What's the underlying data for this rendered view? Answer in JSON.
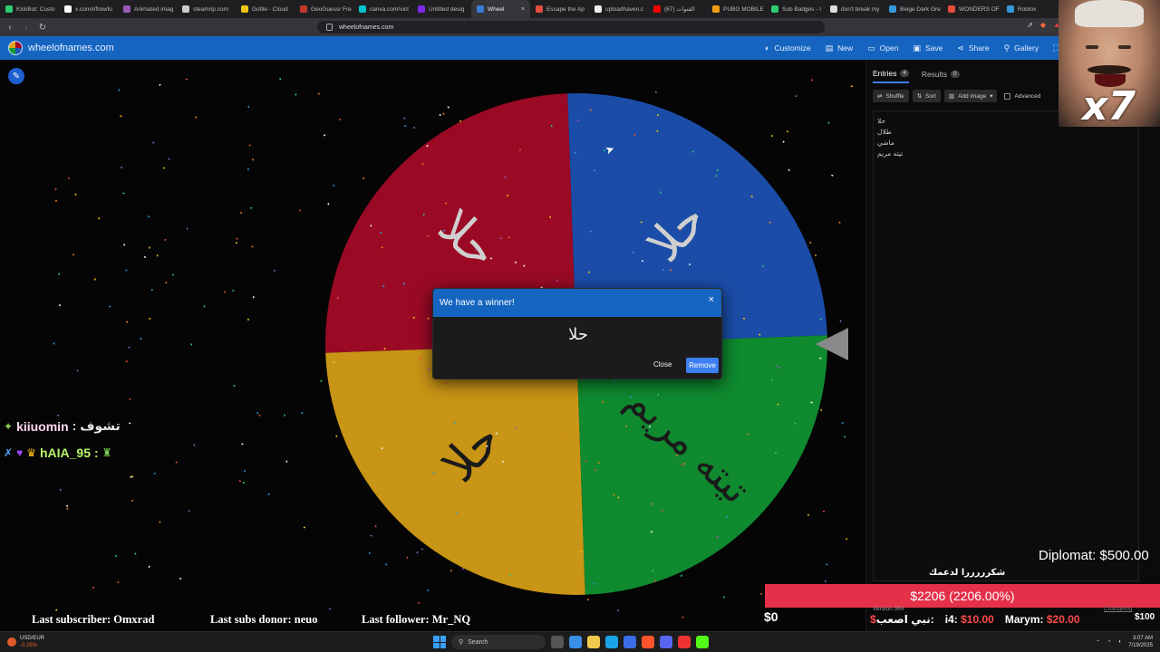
{
  "browser": {
    "tabs": [
      {
        "label": "KickBot: Custo",
        "color": "#2ecc71"
      },
      {
        "label": "x.com/i/flow/lo",
        "color": "#ffffff"
      },
      {
        "label": "Animated imag",
        "color": "#9b59b6"
      },
      {
        "label": "steamrip.com",
        "color": "#cccccc"
      },
      {
        "label": "Gofile - Cloud",
        "color": "#f1c40f"
      },
      {
        "label": "GeoGuessr Fre",
        "color": "#c0392b"
      },
      {
        "label": "canva.com/vict",
        "color": "#00c4cc"
      },
      {
        "label": "Untitled desig",
        "color": "#7d2ae8"
      },
      {
        "label": "Wheel",
        "color": "#3a7bd5",
        "active": true,
        "close": "×"
      },
      {
        "label": "Escape the Ap",
        "color": "#e74c3c"
      },
      {
        "label": "uploadhaven.c",
        "color": "#eeeeee"
      },
      {
        "label": "(67) القنوات",
        "color": "#ff0000"
      },
      {
        "label": "PUBG MOBILE",
        "color": "#f39c12"
      },
      {
        "label": "Sub Badges - I",
        "color": "#2ecc71"
      },
      {
        "label": "don't break my",
        "color": "#dddddd"
      },
      {
        "label": "Beige Dark Gre",
        "color": "#3498db"
      },
      {
        "label": "WONDERS OF",
        "color": "#e74c3c"
      },
      {
        "label": "Roblox",
        "color": "#3498db"
      }
    ],
    "url": "wheelofnames.com"
  },
  "site": {
    "name": "wheelofnames.com",
    "menu": [
      {
        "icon": "palette-icon",
        "glyph": "◐",
        "label": "Customize"
      },
      {
        "icon": "new-file-icon",
        "glyph": "▤",
        "label": "New"
      },
      {
        "icon": "folder-open-icon",
        "glyph": "▭",
        "label": "Open"
      },
      {
        "icon": "save-icon",
        "glyph": "▣",
        "label": "Save"
      },
      {
        "icon": "share-icon",
        "glyph": "⋖",
        "label": "Share"
      },
      {
        "icon": "search-icon",
        "glyph": "⚲",
        "label": "Gallery"
      },
      {
        "icon": "fullscreen-icon",
        "glyph": "⛶",
        "label": ""
      }
    ]
  },
  "wheel": {
    "segments": [
      {
        "label": "حلا",
        "color": "#9a0a25",
        "text_color": "#cfcfcf"
      },
      {
        "label": "طلال",
        "color": "#1b4da8",
        "text_color": "#cfcfcf"
      },
      {
        "label": "ماضي",
        "color": "#0f8a2f",
        "text_color": "#1a1a1a"
      },
      {
        "label": "تيته مريم",
        "color": "#c99516",
        "text_color": "#1a1a1a"
      }
    ],
    "displayed": [
      {
        "label": "حلا",
        "segment": 0
      },
      {
        "label": "حلا",
        "segment": 1
      },
      {
        "label": "تيته مريم",
        "segment": 2
      },
      {
        "label": "حلا",
        "segment": 3
      }
    ]
  },
  "modal": {
    "title": "We have a winner!",
    "close_x": "×",
    "winner": "حلا",
    "close_label": "Close",
    "remove_label": "Remove"
  },
  "panel": {
    "tabs": [
      {
        "label": "Entries",
        "count": "4",
        "active": true
      },
      {
        "label": "Results",
        "count": "0",
        "active": false
      }
    ],
    "tools": [
      "Shuffle",
      "Sort",
      "Add image"
    ],
    "advanced_label": "Advanced",
    "entries": [
      "حلا",
      "طلال",
      "ماضي",
      "تيته مريم"
    ]
  },
  "overlay": {
    "multiplier": "x7",
    "chat": [
      {
        "user": "kiiuomin",
        "message": ": تشوف"
      },
      {
        "user": "hAIA_95",
        "message": ":"
      }
    ],
    "last_subscriber": "Last subscriber: Omxrad",
    "last_subs_donor": "Last subs donor: neuo",
    "last_follower": "Last follower: Mr_NQ",
    "diplomat": "Diplomat: $500.00",
    "thanks": "شكرررررا لدعمك",
    "goal": "$2206 (2206.00%)",
    "zero": "$0",
    "version": "Version 364",
    "changelog": "Changelog",
    "donors": [
      {
        "name": "نبي اصعب:",
        "amount": "$",
        "prefix": true
      },
      {
        "name": "i4:",
        "amount": "$10.00"
      },
      {
        "name": "Marym:",
        "amount": "$20.00"
      }
    ],
    "s100": "$100"
  },
  "taskbar": {
    "weather_line1": "USD/EUR",
    "weather_line2": "-0.26%",
    "search": "Search",
    "time": "3:07 AM",
    "date": "7/19/2025"
  }
}
